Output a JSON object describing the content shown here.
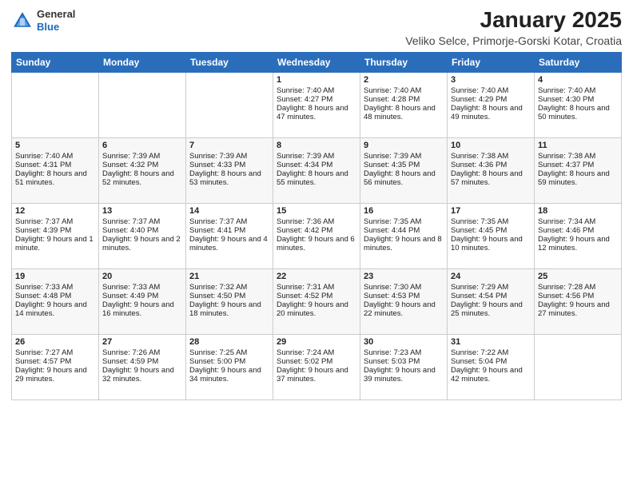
{
  "header": {
    "logo_line1": "General",
    "logo_line2": "Blue",
    "month_title": "January 2025",
    "location": "Veliko Selce, Primorje-Gorski Kotar, Croatia"
  },
  "days_of_week": [
    "Sunday",
    "Monday",
    "Tuesday",
    "Wednesday",
    "Thursday",
    "Friday",
    "Saturday"
  ],
  "weeks": [
    [
      {
        "day": "",
        "content": ""
      },
      {
        "day": "",
        "content": ""
      },
      {
        "day": "",
        "content": ""
      },
      {
        "day": "1",
        "content": "Sunrise: 7:40 AM\nSunset: 4:27 PM\nDaylight: 8 hours and 47 minutes."
      },
      {
        "day": "2",
        "content": "Sunrise: 7:40 AM\nSunset: 4:28 PM\nDaylight: 8 hours and 48 minutes."
      },
      {
        "day": "3",
        "content": "Sunrise: 7:40 AM\nSunset: 4:29 PM\nDaylight: 8 hours and 49 minutes."
      },
      {
        "day": "4",
        "content": "Sunrise: 7:40 AM\nSunset: 4:30 PM\nDaylight: 8 hours and 50 minutes."
      }
    ],
    [
      {
        "day": "5",
        "content": "Sunrise: 7:40 AM\nSunset: 4:31 PM\nDaylight: 8 hours and 51 minutes."
      },
      {
        "day": "6",
        "content": "Sunrise: 7:39 AM\nSunset: 4:32 PM\nDaylight: 8 hours and 52 minutes."
      },
      {
        "day": "7",
        "content": "Sunrise: 7:39 AM\nSunset: 4:33 PM\nDaylight: 8 hours and 53 minutes."
      },
      {
        "day": "8",
        "content": "Sunrise: 7:39 AM\nSunset: 4:34 PM\nDaylight: 8 hours and 55 minutes."
      },
      {
        "day": "9",
        "content": "Sunrise: 7:39 AM\nSunset: 4:35 PM\nDaylight: 8 hours and 56 minutes."
      },
      {
        "day": "10",
        "content": "Sunrise: 7:38 AM\nSunset: 4:36 PM\nDaylight: 8 hours and 57 minutes."
      },
      {
        "day": "11",
        "content": "Sunrise: 7:38 AM\nSunset: 4:37 PM\nDaylight: 8 hours and 59 minutes."
      }
    ],
    [
      {
        "day": "12",
        "content": "Sunrise: 7:37 AM\nSunset: 4:39 PM\nDaylight: 9 hours and 1 minute."
      },
      {
        "day": "13",
        "content": "Sunrise: 7:37 AM\nSunset: 4:40 PM\nDaylight: 9 hours and 2 minutes."
      },
      {
        "day": "14",
        "content": "Sunrise: 7:37 AM\nSunset: 4:41 PM\nDaylight: 9 hours and 4 minutes."
      },
      {
        "day": "15",
        "content": "Sunrise: 7:36 AM\nSunset: 4:42 PM\nDaylight: 9 hours and 6 minutes."
      },
      {
        "day": "16",
        "content": "Sunrise: 7:35 AM\nSunset: 4:44 PM\nDaylight: 9 hours and 8 minutes."
      },
      {
        "day": "17",
        "content": "Sunrise: 7:35 AM\nSunset: 4:45 PM\nDaylight: 9 hours and 10 minutes."
      },
      {
        "day": "18",
        "content": "Sunrise: 7:34 AM\nSunset: 4:46 PM\nDaylight: 9 hours and 12 minutes."
      }
    ],
    [
      {
        "day": "19",
        "content": "Sunrise: 7:33 AM\nSunset: 4:48 PM\nDaylight: 9 hours and 14 minutes."
      },
      {
        "day": "20",
        "content": "Sunrise: 7:33 AM\nSunset: 4:49 PM\nDaylight: 9 hours and 16 minutes."
      },
      {
        "day": "21",
        "content": "Sunrise: 7:32 AM\nSunset: 4:50 PM\nDaylight: 9 hours and 18 minutes."
      },
      {
        "day": "22",
        "content": "Sunrise: 7:31 AM\nSunset: 4:52 PM\nDaylight: 9 hours and 20 minutes."
      },
      {
        "day": "23",
        "content": "Sunrise: 7:30 AM\nSunset: 4:53 PM\nDaylight: 9 hours and 22 minutes."
      },
      {
        "day": "24",
        "content": "Sunrise: 7:29 AM\nSunset: 4:54 PM\nDaylight: 9 hours and 25 minutes."
      },
      {
        "day": "25",
        "content": "Sunrise: 7:28 AM\nSunset: 4:56 PM\nDaylight: 9 hours and 27 minutes."
      }
    ],
    [
      {
        "day": "26",
        "content": "Sunrise: 7:27 AM\nSunset: 4:57 PM\nDaylight: 9 hours and 29 minutes."
      },
      {
        "day": "27",
        "content": "Sunrise: 7:26 AM\nSunset: 4:59 PM\nDaylight: 9 hours and 32 minutes."
      },
      {
        "day": "28",
        "content": "Sunrise: 7:25 AM\nSunset: 5:00 PM\nDaylight: 9 hours and 34 minutes."
      },
      {
        "day": "29",
        "content": "Sunrise: 7:24 AM\nSunset: 5:02 PM\nDaylight: 9 hours and 37 minutes."
      },
      {
        "day": "30",
        "content": "Sunrise: 7:23 AM\nSunset: 5:03 PM\nDaylight: 9 hours and 39 minutes."
      },
      {
        "day": "31",
        "content": "Sunrise: 7:22 AM\nSunset: 5:04 PM\nDaylight: 9 hours and 42 minutes."
      },
      {
        "day": "",
        "content": ""
      }
    ]
  ]
}
